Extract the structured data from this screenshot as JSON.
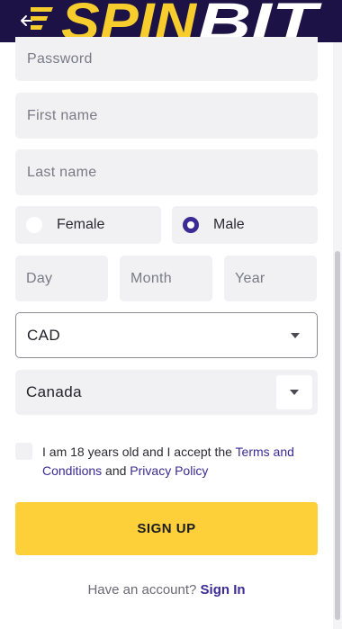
{
  "header": {
    "brand": "SPINBIT",
    "back_icon": "arrow-left-icon",
    "colors": {
      "background": "#1c1245",
      "logo_yellow": "#f7cd2e",
      "logo_white": "#ffffff"
    }
  },
  "form": {
    "password_placeholder": "Password",
    "first_name_placeholder": "First name",
    "last_name_placeholder": "Last name",
    "gender": {
      "female_label": "Female",
      "male_label": "Male",
      "selected": "Male"
    },
    "dob": {
      "day_placeholder": "Day",
      "month_placeholder": "Month",
      "year_placeholder": "Year"
    },
    "currency_value": "CAD",
    "country_value": "Canada",
    "terms": {
      "prefix": "I am 18 years old and I accept the ",
      "terms_link": "Terms and Conditions",
      "and": " and ",
      "privacy_link": "Privacy Policy",
      "checked": false
    },
    "signup_label": "SIGN UP",
    "account_prompt": "Have an account?",
    "signin_link": "Sign In"
  },
  "colors": {
    "accent": "#3c2b94",
    "button": "#fdd03a",
    "field_bg": "#f1f1f4"
  }
}
